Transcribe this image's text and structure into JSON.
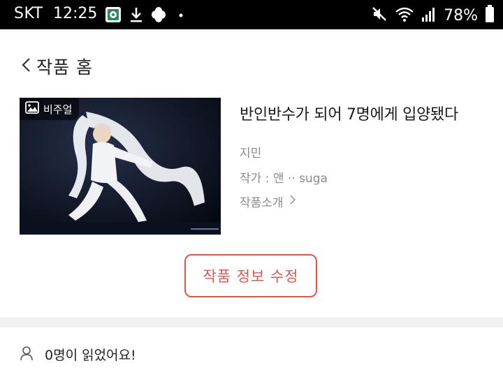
{
  "status_bar": {
    "carrier": "SKT",
    "time": "12:25",
    "battery": "78%",
    "icons": [
      "app-notification-icon",
      "download-icon",
      "plus-app-icon",
      "dot-icon",
      "mute-icon",
      "wifi-icon",
      "signal-icon"
    ]
  },
  "header": {
    "back_label": "작품 홈"
  },
  "work": {
    "badge_label": "비주얼",
    "title": "반인반수가 되어 7명에게 입양됐다",
    "tag": "지민",
    "author": "작가 : 앤 ·· suga",
    "intro_label": "작품소개"
  },
  "actions": {
    "edit_label": "작품 정보 수정"
  },
  "stats": {
    "readers_text": "0명이 읽었어요!"
  },
  "colors": {
    "accent": "#e0554e",
    "status_bar_bg": "#000000",
    "divider": "#eef0f2",
    "meta_text": "#8a8a8a"
  }
}
